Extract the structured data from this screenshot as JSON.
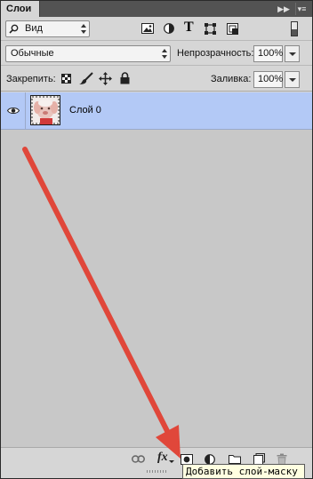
{
  "panel": {
    "tab_label": "Слои"
  },
  "filter": {
    "kind_label": "Вид"
  },
  "blend": {
    "mode": "Обычные",
    "opacity_label": "Непрозрачность:",
    "opacity_value": "100%"
  },
  "lock": {
    "label": "Закрепить:",
    "fill_label": "Заливка:",
    "fill_value": "100%"
  },
  "layers": [
    {
      "name": "Слой 0",
      "visible": true,
      "selected": true
    }
  ],
  "bottom": {
    "fx_label": "fx"
  },
  "tooltip": {
    "text": "Добавить слой-маску"
  },
  "colors": {
    "selected_row": "#b3c9f6",
    "arrow": "#e0473a",
    "tooltip_bg": "#ffffe1"
  }
}
